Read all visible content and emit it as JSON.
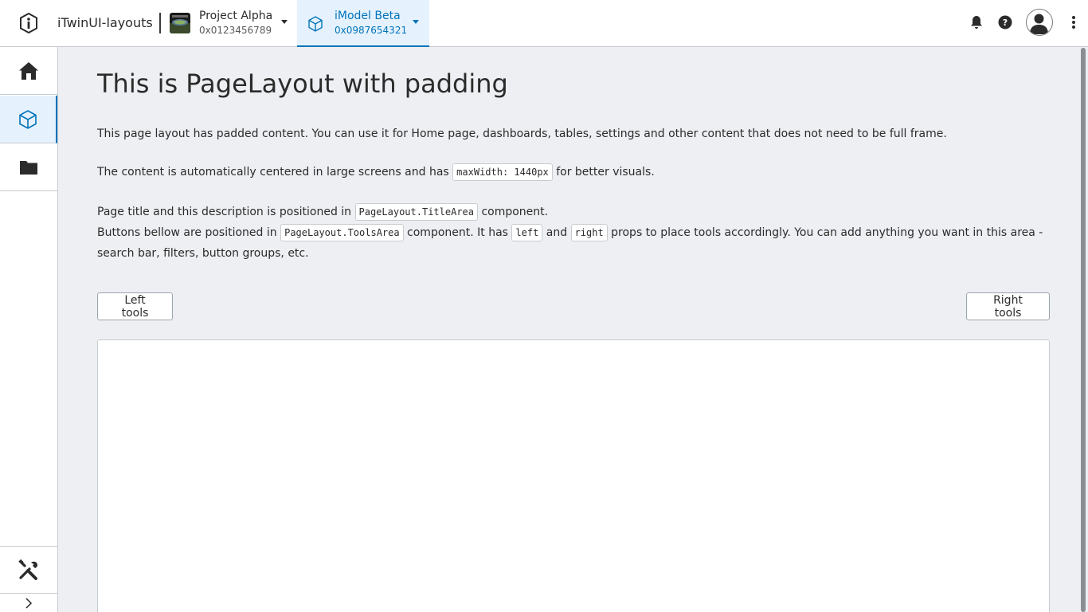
{
  "header": {
    "app_name": "iTwinUI-layouts",
    "project": {
      "title": "Project Alpha",
      "id": "0x0123456789"
    },
    "imodel": {
      "title": "iModel Beta",
      "id": "0x0987654321"
    }
  },
  "sidebar": {
    "items": [
      {
        "name": "home",
        "icon": "home-icon",
        "active": false
      },
      {
        "name": "model",
        "icon": "cube-icon",
        "active": true
      },
      {
        "name": "folder",
        "icon": "folder-icon",
        "active": false
      },
      {
        "name": "tools",
        "icon": "tools-icon",
        "active": false
      }
    ],
    "expand_icon": "chevron-right-icon"
  },
  "main": {
    "title": "This is PageLayout with padding",
    "p1": "This page layout has padded content. You can use it for Home page, dashboards, tables, settings and other content that does not need to be full frame.",
    "p2": {
      "before": "The content is automatically centered in large screens and has ",
      "code": "maxWidth: 1440px",
      "after": " for better visuals."
    },
    "p3": {
      "before": "Page title and this description is positioned in ",
      "code": "PageLayout.TitleArea",
      "after": " component."
    },
    "p4": {
      "before": "Buttons bellow are positioned in ",
      "code1": "PageLayout.ToolsArea",
      "mid1": " component. It has ",
      "code2": "left",
      "mid2": " and ",
      "code3": "right",
      "after": " props to place tools accordingly. You can add anything you want in this area - search bar, filters, button groups, etc."
    },
    "left_button": "Left tools",
    "right_button": "Right tools"
  },
  "colors": {
    "accent": "#0073ba",
    "accent_bg": "#e5f2fd",
    "page_bg": "#edeff2"
  }
}
